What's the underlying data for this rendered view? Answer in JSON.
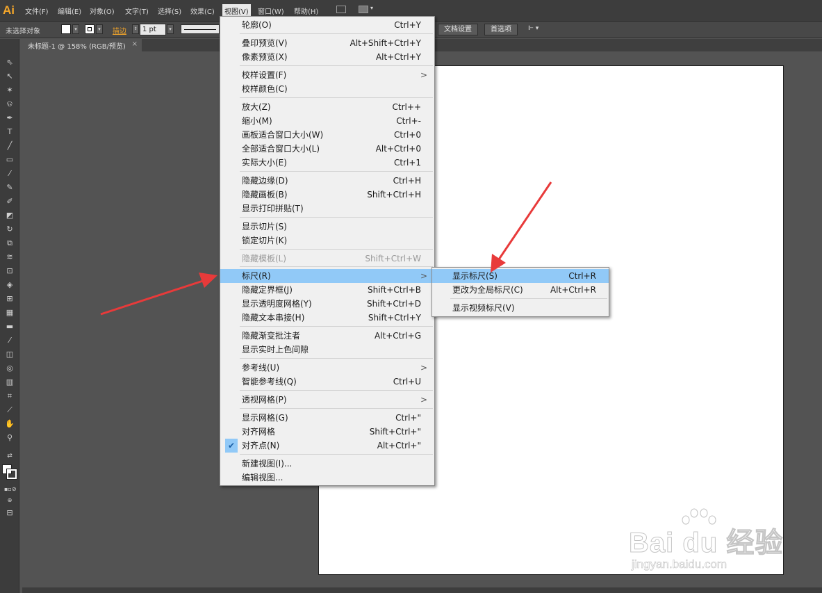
{
  "app": {
    "logo": "Ai",
    "menu": [
      "文件(F)",
      "编辑(E)",
      "对象(O)",
      "文字(T)",
      "选择(S)",
      "效果(C)",
      "视图(V)",
      "窗口(W)",
      "帮助(H)"
    ]
  },
  "control_bar": {
    "selection_status": "未选择对象",
    "stroke_label": "描边",
    "stroke_weight": "1 pt",
    "doc_setup_button": "文档设置",
    "preferences_button": "首选项"
  },
  "document_tab": {
    "title": "未标题-1 @ 158% (RGB/预览)",
    "close": "×"
  },
  "view_menu": {
    "items": [
      {
        "label": "轮廓(O)",
        "shortcut": "Ctrl+Y"
      },
      {
        "label": "叠印预览(V)",
        "shortcut": "Alt+Shift+Ctrl+Y"
      },
      {
        "label": "像素预览(X)",
        "shortcut": "Alt+Ctrl+Y"
      },
      {
        "label": "校样设置(F)",
        "submenu": ">"
      },
      {
        "label": "校样颜色(C)"
      },
      {
        "label": "放大(Z)",
        "shortcut": "Ctrl++"
      },
      {
        "label": "缩小(M)",
        "shortcut": "Ctrl+-"
      },
      {
        "label": "画板适合窗口大小(W)",
        "shortcut": "Ctrl+0"
      },
      {
        "label": "全部适合窗口大小(L)",
        "shortcut": "Alt+Ctrl+0"
      },
      {
        "label": "实际大小(E)",
        "shortcut": "Ctrl+1"
      },
      {
        "label": "隐藏边缘(D)",
        "shortcut": "Ctrl+H"
      },
      {
        "label": "隐藏画板(B)",
        "shortcut": "Shift+Ctrl+H"
      },
      {
        "label": "显示打印拼贴(T)"
      },
      {
        "label": "显示切片(S)"
      },
      {
        "label": "锁定切片(K)"
      },
      {
        "label": "隐藏模板(L)",
        "shortcut": "Shift+Ctrl+W",
        "disabled": true
      },
      {
        "label": "标尺(R)",
        "submenu": ">",
        "highlighted": true
      },
      {
        "label": "隐藏定界框(J)",
        "shortcut": "Shift+Ctrl+B"
      },
      {
        "label": "显示透明度网格(Y)",
        "shortcut": "Shift+Ctrl+D"
      },
      {
        "label": "隐藏文本串接(H)",
        "shortcut": "Shift+Ctrl+Y"
      },
      {
        "label": "隐藏渐变批注者",
        "shortcut": "Alt+Ctrl+G"
      },
      {
        "label": "显示实时上色间隙"
      },
      {
        "label": "参考线(U)",
        "submenu": ">"
      },
      {
        "label": "智能参考线(Q)",
        "shortcut": "Ctrl+U"
      },
      {
        "label": "透视网格(P)",
        "submenu": ">"
      },
      {
        "label": "显示网格(G)",
        "shortcut": "Ctrl+\""
      },
      {
        "label": "对齐网格",
        "shortcut": "Shift+Ctrl+\""
      },
      {
        "label": "对齐点(N)",
        "shortcut": "Alt+Ctrl+\"",
        "checked": true
      },
      {
        "label": "新建视图(I)..."
      },
      {
        "label": "编辑视图..."
      }
    ]
  },
  "ruler_submenu": {
    "items": [
      {
        "label": "显示标尺(S)",
        "shortcut": "Ctrl+R",
        "highlighted": true
      },
      {
        "label": "更改为全局标尺(C)",
        "shortcut": "Alt+Ctrl+R"
      },
      {
        "label": "显示视频标尺(V)"
      }
    ]
  },
  "watermark": {
    "brand": "Bai du 经验",
    "url": "jingyan.baidu.com"
  },
  "colors": {
    "menu_highlight": "#91c9f7",
    "annotation_arrow": "#e83a3a",
    "logo": "#f4a62a",
    "workspace": "#535353"
  }
}
